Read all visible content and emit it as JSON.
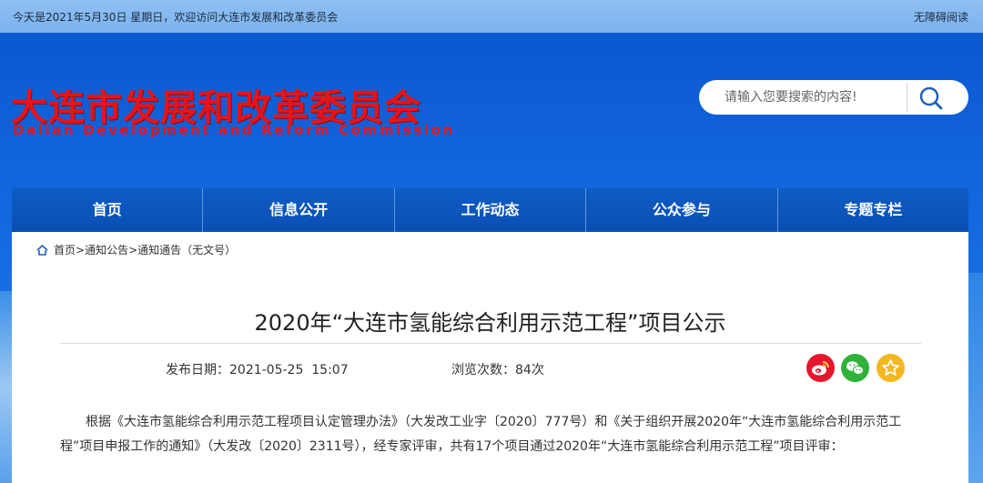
{
  "topbar": {
    "greeting": "今天是2021年5月30日 星期日，欢迎访问大连市发展和改革委员会",
    "accessibility": "无障碍阅读"
  },
  "logo": {
    "cn": "大连市发展和改革委员会",
    "en": "Dalian Development and Reform Commission"
  },
  "search": {
    "placeholder": "请输入您要搜索的内容!",
    "icon": "search-icon"
  },
  "nav": {
    "items": [
      "首页",
      "信息公开",
      "工作动态",
      "公众参与",
      "专题专栏"
    ]
  },
  "breadcrumb": {
    "items": [
      "首页",
      "通知公告",
      "通知通告（无文号）"
    ],
    "separator": ">"
  },
  "article": {
    "title": "2020年“大连市氢能综合利用示范工程”项目公示",
    "date_label": "发布日期：",
    "date_value": "2021-05-25  15:07",
    "views_label": "浏览次数：",
    "views_value": "84次",
    "body": "根据《大连市氢能综合利用示范工程项目认定管理办法》（大发改工业字〔2020〕777号）和《关于组织开展2020年“大连市氢能综合利用示范工程”项目申报工作的通知》（大发改〔2020〕2311号），经专家评审，共有17个项目通过2020年“大连市氢能综合利用示范工程”项目评审："
  },
  "share": {
    "icons": [
      "weibo-icon",
      "wechat-icon",
      "favorite-icon"
    ]
  },
  "colors": {
    "brand_red": "#e4141b",
    "nav_blue": "#0a4fb3",
    "weibo": "#e6162d",
    "wechat": "#2fb239",
    "favorite": "#f3b81f"
  }
}
